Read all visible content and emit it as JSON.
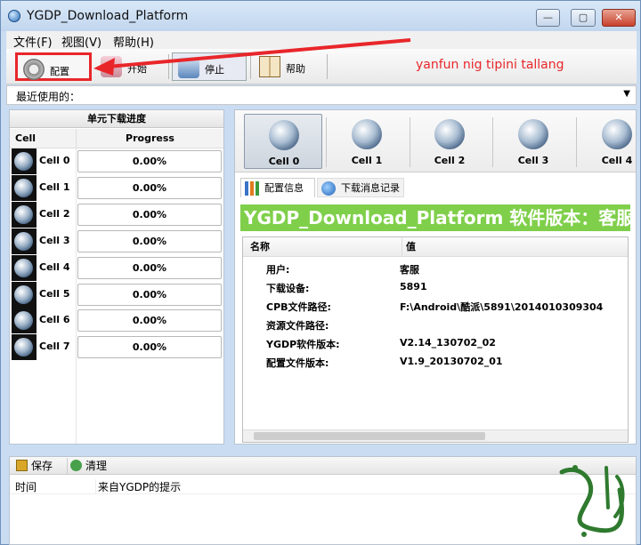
{
  "window": {
    "title": "YGDP_Download_Platform",
    "min_label": "—",
    "max_label": "▢",
    "close_label": "✕"
  },
  "menu": [
    "文件(F)",
    "视图(V)",
    "帮助(H)"
  ],
  "toolbar": {
    "config": "配置",
    "start": "开始",
    "stop": "停止",
    "help": "帮助"
  },
  "annotation": "yanfun nig tipini tallang",
  "recent": {
    "label": "最近使用的："
  },
  "left_panel": {
    "title": "单元下载进度",
    "col_cell": "Cell",
    "col_progress": "Progress",
    "cells": [
      {
        "name": "Cell 0",
        "progress": "0.00%"
      },
      {
        "name": "Cell 1",
        "progress": "0.00%"
      },
      {
        "name": "Cell 2",
        "progress": "0.00%"
      },
      {
        "name": "Cell 3",
        "progress": "0.00%"
      },
      {
        "name": "Cell 4",
        "progress": "0.00%"
      },
      {
        "name": "Cell 5",
        "progress": "0.00%"
      },
      {
        "name": "Cell 6",
        "progress": "0.00%"
      },
      {
        "name": "Cell 7",
        "progress": "0.00%"
      }
    ]
  },
  "cell_strip": [
    "Cell 0",
    "Cell 1",
    "Cell 2",
    "Cell 3",
    "Cell 4"
  ],
  "tabs": {
    "config_info": "配置信息",
    "download_log": "下载消息记录"
  },
  "banner": "YGDP_Download_Platform 软件版本：客服",
  "info": {
    "col_name": "名称",
    "col_value": "值",
    "rows": [
      {
        "k": "用户:",
        "v": "客服"
      },
      {
        "k": "下载设备:",
        "v": "5891"
      },
      {
        "k": "CPB文件路径:",
        "v": "F:\\Android\\酷派\\5891\\2014010309304"
      },
      {
        "k": "资源文件路径:",
        "v": ""
      },
      {
        "k": "YGDP软件版本:",
        "v": "V2.14_130702_02"
      },
      {
        "k": "配置文件版本:",
        "v": "V1.9_20130702_01"
      }
    ]
  },
  "bottom": {
    "save": "保存",
    "clean": "清理",
    "col_time": "时间",
    "col_msg": "来自YGDP的提示"
  }
}
